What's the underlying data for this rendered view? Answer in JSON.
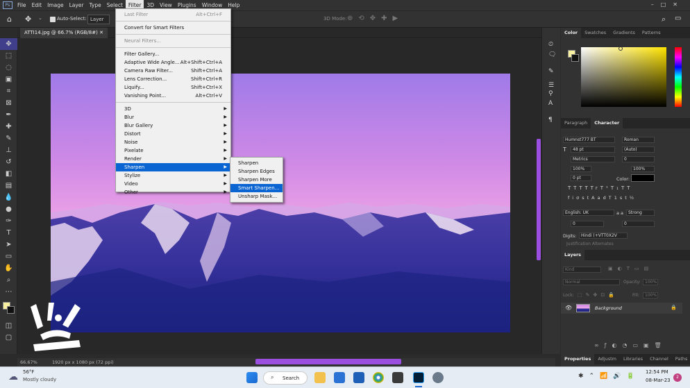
{
  "app": {
    "logo": "Ps"
  },
  "menubar": {
    "items": [
      "File",
      "Edit",
      "Image",
      "Layer",
      "Type",
      "Select",
      "Filter",
      "3D",
      "View",
      "Plugins",
      "Window",
      "Help"
    ],
    "active": "Filter"
  },
  "options_bar": {
    "auto_select_label": "Auto-Select:",
    "auto_select_value": "Layer",
    "mode_3d_label": "3D Mode:"
  },
  "document": {
    "tab_title": "ATTI14.jpg @ 66.7% (RGB/8#)",
    "zoom": "66.67%",
    "doc_info": "1920 px x 1080 px (72 ppi)"
  },
  "filter_menu": {
    "items": [
      {
        "label": "Last Filter",
        "shortcut": "Alt+Ctrl+F",
        "disabled": true
      },
      {
        "sep": true
      },
      {
        "label": "Convert for Smart Filters"
      },
      {
        "sep": true
      },
      {
        "label": "Neural Filters...",
        "disabled": true
      },
      {
        "sep": true
      },
      {
        "label": "Filter Gallery..."
      },
      {
        "label": "Adaptive Wide Angle...",
        "shortcut": "Alt+Shift+Ctrl+A"
      },
      {
        "label": "Camera Raw Filter...",
        "shortcut": "Shift+Ctrl+A"
      },
      {
        "label": "Lens Correction...",
        "shortcut": "Shift+Ctrl+R"
      },
      {
        "label": "Liquify...",
        "shortcut": "Shift+Ctrl+X"
      },
      {
        "label": "Vanishing Point...",
        "shortcut": "Alt+Ctrl+V"
      },
      {
        "sep": true
      },
      {
        "label": "3D",
        "sub": true
      },
      {
        "label": "Blur",
        "sub": true
      },
      {
        "label": "Blur Gallery",
        "sub": true
      },
      {
        "label": "Distort",
        "sub": true
      },
      {
        "label": "Noise",
        "sub": true
      },
      {
        "label": "Pixelate",
        "sub": true
      },
      {
        "label": "Render",
        "sub": true
      },
      {
        "label": "Sharpen",
        "sub": true,
        "highlighted": true
      },
      {
        "label": "Stylize",
        "sub": true
      },
      {
        "label": "Video",
        "sub": true
      },
      {
        "label": "Other",
        "sub": true
      }
    ]
  },
  "sharpen_submenu": {
    "items": [
      {
        "label": "Sharpen"
      },
      {
        "label": "Sharpen Edges"
      },
      {
        "label": "Sharpen More"
      },
      {
        "label": "Smart Sharpen...",
        "highlighted": true
      },
      {
        "label": "Unsharp Mask..."
      }
    ]
  },
  "color_panel": {
    "tabs": [
      "Color",
      "Swatches",
      "Gradients",
      "Patterns"
    ],
    "active": "Color",
    "foreground": "#f7f0a0",
    "hue_color": "#ffe400"
  },
  "character_panel": {
    "tabs": [
      "Paragraph",
      "Character"
    ],
    "active": "Character",
    "font_family": "Humnst777 BT",
    "font_style": "Roman",
    "font_size": "48 pt",
    "leading": "(Auto)",
    "kerning": "Metrics",
    "tracking": "0",
    "vertical_scale": "100%",
    "horizontal_scale": "100%",
    "baseline_shift": "0 pt",
    "color_label": "Color:",
    "type_styles": [
      "T",
      "T",
      "TT",
      "Tr",
      "T¹",
      "T₁",
      "T",
      "T"
    ],
    "opentype": [
      "fi",
      "σ",
      "st",
      "A",
      "ad",
      "T",
      "1st",
      "½"
    ],
    "language": "English: UK",
    "aa_method": "Strong",
    "aa_icon": "a a",
    "lang_field1": "0",
    "lang_field2": "0",
    "digits_label": "Digits:",
    "digits_value": "Hindi (+VTT0X2V",
    "justification": "Justification Alternates"
  },
  "layers_panel": {
    "title": "Layers",
    "kind_label": "Kind",
    "blend_mode": "Normal",
    "opacity_label": "Opacity:",
    "opacity": "100%",
    "lock_label": "Lock:",
    "fill_label": "Fill:",
    "fill": "100%",
    "layers": [
      {
        "name": "Background",
        "visible": true,
        "locked": true
      }
    ]
  },
  "bottom_tabs": [
    "Properties",
    "Adjustm",
    "Libraries",
    "Channel",
    "Paths"
  ],
  "taskbar": {
    "weather_temp": "56°F",
    "weather_desc": "Mostly cloudy",
    "search_label": "Search",
    "time": "12:54 PM",
    "date": "08-Mar-23",
    "notification_count": "2"
  }
}
